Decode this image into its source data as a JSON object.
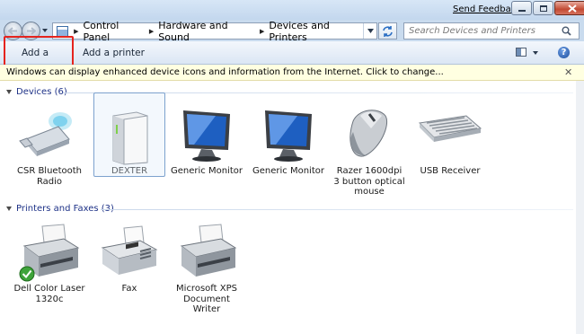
{
  "window": {
    "send_feedback": "Send Feedback"
  },
  "address": {
    "crumbs": [
      "Control Panel",
      "Hardware and Sound",
      "Devices and Printers"
    ]
  },
  "search": {
    "placeholder": "Search Devices and Printers"
  },
  "toolbar": {
    "add_device": "Add a device",
    "add_printer": "Add a printer"
  },
  "infobar": {
    "text": "Windows can display enhanced device icons and information from the Internet. Click to change..."
  },
  "groups": {
    "devices": {
      "header": "Devices (6)",
      "items": [
        {
          "label": "CSR Bluetooth Radio",
          "icon": "usb-bluetooth-dongle-icon"
        },
        {
          "label": "DEXTER",
          "icon": "computer-tower-icon"
        },
        {
          "label": "Generic Monitor",
          "icon": "monitor-icon"
        },
        {
          "label": "Generic Monitor",
          "icon": "monitor-icon"
        },
        {
          "label": "Razer 1600dpi 3 button optical mouse",
          "icon": "mouse-icon"
        },
        {
          "label": "USB Receiver",
          "icon": "keyboard-icon"
        }
      ]
    },
    "printers": {
      "header": "Printers and Faxes (3)",
      "items": [
        {
          "label": "Dell Color Laser 1320c",
          "icon": "printer-icon",
          "default": true
        },
        {
          "label": "Fax",
          "icon": "fax-icon"
        },
        {
          "label": "Microsoft XPS Document Writer",
          "icon": "printer-icon"
        }
      ]
    }
  },
  "colors": {
    "highlight": "#e5241e",
    "infobar_bg": "#ffffe1",
    "group_header": "#1e3287"
  }
}
